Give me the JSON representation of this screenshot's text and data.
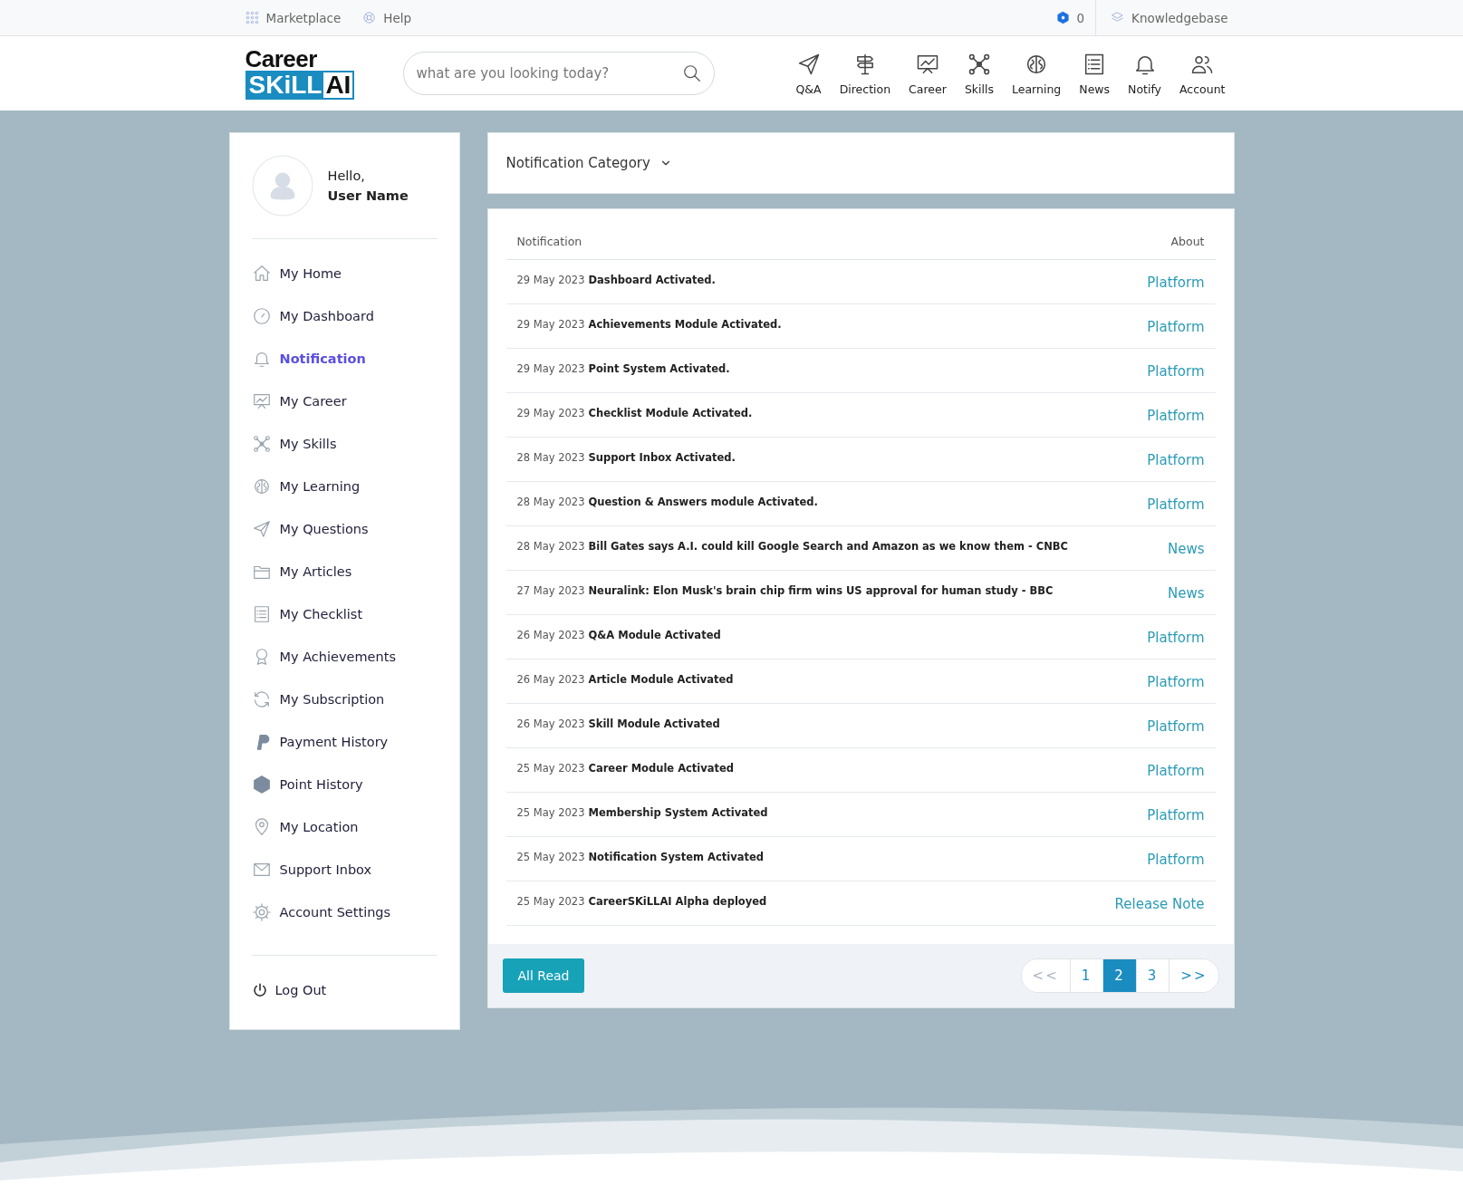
{
  "top_bar": {
    "left_links": [
      "Marketplace",
      "Help"
    ],
    "points": "0",
    "right_link": "Knowledgebase"
  },
  "logo": {
    "line1": "Career",
    "part1": "SKiLL",
    "part2": "AI"
  },
  "search": {
    "placeholder": "what are you looking today?"
  },
  "nav": [
    "Q&A",
    "Direction",
    "Career",
    "Skills",
    "Learning",
    "News",
    "Notify",
    "Account"
  ],
  "profile": {
    "greeting": "Hello,",
    "name": "User Name"
  },
  "sidebar": {
    "items": [
      {
        "label": "My Home",
        "selected": false
      },
      {
        "label": "My Dashboard",
        "selected": false
      },
      {
        "label": "Notification",
        "selected": true
      },
      {
        "label": "My Career",
        "selected": false
      },
      {
        "label": "My Skills",
        "selected": false
      },
      {
        "label": "My Learning",
        "selected": false
      },
      {
        "label": "My Questions",
        "selected": false
      },
      {
        "label": "My Articles",
        "selected": false
      },
      {
        "label": "My Checklist",
        "selected": false
      },
      {
        "label": "My Achievements",
        "selected": false
      },
      {
        "label": "My Subscription",
        "selected": false
      },
      {
        "label": "Payment History",
        "selected": false
      },
      {
        "label": "Point History",
        "selected": false
      },
      {
        "label": "My Location",
        "selected": false
      },
      {
        "label": "Support Inbox",
        "selected": false
      },
      {
        "label": "Account Settings",
        "selected": false
      }
    ],
    "logout": "Log Out"
  },
  "category_dropdown": "Notification Category",
  "table": {
    "columns": [
      "Notification",
      "About"
    ],
    "rows": [
      {
        "date": "29 May 2023",
        "text": "Dashboard Activated.",
        "about": "Platform"
      },
      {
        "date": "29 May 2023",
        "text": "Achievements Module Activated.",
        "about": "Platform"
      },
      {
        "date": "29 May 2023",
        "text": "Point System Activated.",
        "about": "Platform"
      },
      {
        "date": "29 May 2023",
        "text": "Checklist Module Activated.",
        "about": "Platform"
      },
      {
        "date": "28 May 2023",
        "text": "Support Inbox Activated.",
        "about": "Platform"
      },
      {
        "date": "28 May 2023",
        "text": "Question & Answers module Activated.",
        "about": "Platform"
      },
      {
        "date": "28 May 2023",
        "text": "Bill Gates says A.I. could kill Google Search and Amazon as we know them - CNBC",
        "about": "News"
      },
      {
        "date": "27 May 2023",
        "text": "Neuralink: Elon Musk's brain chip firm wins US approval for human study - BBC",
        "about": "News"
      },
      {
        "date": "26 May 2023",
        "text": "Q&A Module Activated",
        "about": "Platform"
      },
      {
        "date": "26 May 2023",
        "text": "Article Module Activated",
        "about": "Platform"
      },
      {
        "date": "26 May 2023",
        "text": "Skill Module Activated",
        "about": "Platform"
      },
      {
        "date": "25 May 2023",
        "text": "Career Module Activated",
        "about": "Platform"
      },
      {
        "date": "25 May 2023",
        "text": "Membership System Activated",
        "about": "Platform"
      },
      {
        "date": "25 May 2023",
        "text": "Notification System Activated",
        "about": "Platform"
      },
      {
        "date": "25 May 2023",
        "text": "CareerSKiLLAI Alpha deployed",
        "about": "Release Note"
      }
    ]
  },
  "all_read_button": "All Read",
  "pagination": [
    {
      "label": "<<",
      "selected": false,
      "disabled": true
    },
    {
      "label": "1",
      "selected": false,
      "disabled": false
    },
    {
      "label": "2",
      "selected": true,
      "disabled": false
    },
    {
      "label": "3",
      "selected": false,
      "disabled": false
    },
    {
      "label": ">>",
      "selected": false,
      "disabled": false
    }
  ]
}
